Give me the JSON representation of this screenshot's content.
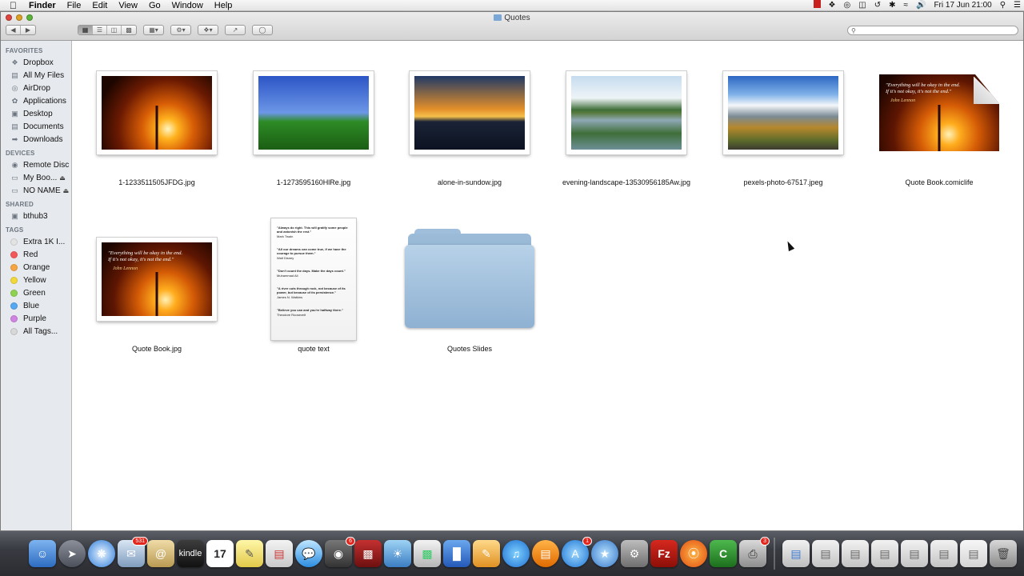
{
  "menubar": {
    "apple": "",
    "items": [
      "Finder",
      "File",
      "Edit",
      "View",
      "Go",
      "Window",
      "Help"
    ],
    "clock": "Fri 17 Jun  21:00"
  },
  "window": {
    "title": "Quotes",
    "search": {
      "placeholder": "",
      "value": ""
    }
  },
  "sidebar": {
    "favorites_header": "FAVORITES",
    "favorites": [
      "Dropbox",
      "All My Files",
      "AirDrop",
      "Applications",
      "Desktop",
      "Documents",
      "Downloads"
    ],
    "devices_header": "DEVICES",
    "devices": [
      "Remote Disc",
      "My Boo...",
      "NO NAME"
    ],
    "shared_header": "SHARED",
    "shared": [
      "bthub3"
    ],
    "tags_header": "TAGS",
    "tags": [
      {
        "label": "Extra 1K I...",
        "color": "#e3e3e3"
      },
      {
        "label": "Red",
        "color": "#f4595a"
      },
      {
        "label": "Orange",
        "color": "#f7a542"
      },
      {
        "label": "Yellow",
        "color": "#f2d83a"
      },
      {
        "label": "Green",
        "color": "#8fd150"
      },
      {
        "label": "Blue",
        "color": "#56a8f2"
      },
      {
        "label": "Purple",
        "color": "#d083e1"
      },
      {
        "label": "All Tags...",
        "color": "#d8d8d8"
      }
    ]
  },
  "files": [
    {
      "name": "1-1233511505JFDG.jpg"
    },
    {
      "name": "1-1273595160HlRe.jpg"
    },
    {
      "name": "alone-in-sundow.jpg"
    },
    {
      "name": "evening-landscape-13530956185Aw.jpg"
    },
    {
      "name": "pexels-photo-67517.jpeg"
    },
    {
      "name": "Quote Book.comiclife"
    },
    {
      "name": "Quote Book.jpg"
    },
    {
      "name": "quote text"
    },
    {
      "name": "Quotes Slides"
    }
  ],
  "quote": {
    "line1": "\"Everything will be okay in the end.",
    "line2": "If it's not okay, it's not the end.\"",
    "author": "John Lennon"
  },
  "quote_doc": [
    "\"Always do right. This will gratify some people and astonish the rest.\"",
    "Mark Twain",
    "\"All our dreams can come true, if we have the courage to pursue them.\"",
    "Walt Disney",
    "\"Don't count the days. Make the days count.\"",
    "Muhammad Ali",
    "\"A river cuts through rock, not because of its power, but because of its persistence.\"",
    "James N. Watkins",
    "\"Believe you can and you're halfway there.\"",
    "Theodore Roosevelt"
  ],
  "dock": {
    "badges": {
      "mail": "531",
      "facetime": "6",
      "appstore": "1",
      "printer": "3"
    },
    "calendar_day": "17",
    "kindle": "kindle"
  }
}
